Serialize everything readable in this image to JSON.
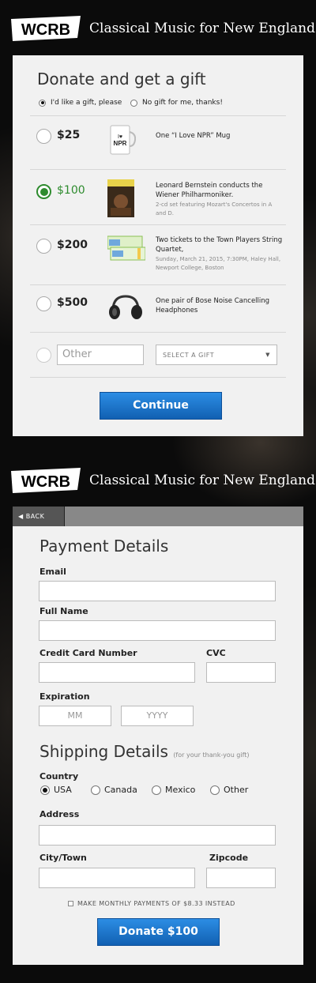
{
  "header": {
    "brand": "WCRB",
    "title": "Classical Music for New England"
  },
  "donate": {
    "title": "Donate and get a gift",
    "gift_options": [
      "I'd like a gift, please",
      "No gift for me, thanks!"
    ],
    "tiers": [
      {
        "amount": "$25",
        "title": "One “I Love NPR” Mug",
        "desc": "",
        "selected": false
      },
      {
        "amount": "$100",
        "title": "Leonard Bernstein conducts the Wiener Philharmoniker.",
        "desc": "2-cd set featuring Mozart's Concertos in A and D.",
        "selected": true
      },
      {
        "amount": "$200",
        "title": "Two tickets to the Town Players String Quartet,",
        "desc": "Sunday, March 21, 2015, 7:30PM, Haley Hall, Newport College, Boston",
        "selected": false
      },
      {
        "amount": "$500",
        "title": "One pair of Bose Noise Cancelling Headphones",
        "desc": "",
        "selected": false
      }
    ],
    "other_placeholder": "Other",
    "select_gift": "SELECT A GIFT",
    "continue_label": "Continue"
  },
  "payment": {
    "back_label": "BACK",
    "title": "Payment Details",
    "email_label": "Email",
    "fullname_label": "Full Name",
    "card_label": "Credit Card Number",
    "cvc_label": "CVC",
    "expiration_label": "Expiration",
    "mm_placeholder": "MM",
    "yyyy_placeholder": "YYYY"
  },
  "shipping": {
    "title": "Shipping Details",
    "note": "(for your thank-you gift)",
    "country_label": "Country",
    "countries": [
      "USA",
      "Canada",
      "Mexico",
      "Other"
    ],
    "selected_country": "USA",
    "address_label": "Address",
    "city_label": "City/Town",
    "zip_label": "Zipcode",
    "monthly_label": "MAKE MONTHLY PAYMENTS OF $8.33 INSTEAD",
    "donate_label": "Donate $100"
  },
  "colors": {
    "accent_green": "#2e8b2e",
    "button_blue": "#1a73c9"
  }
}
